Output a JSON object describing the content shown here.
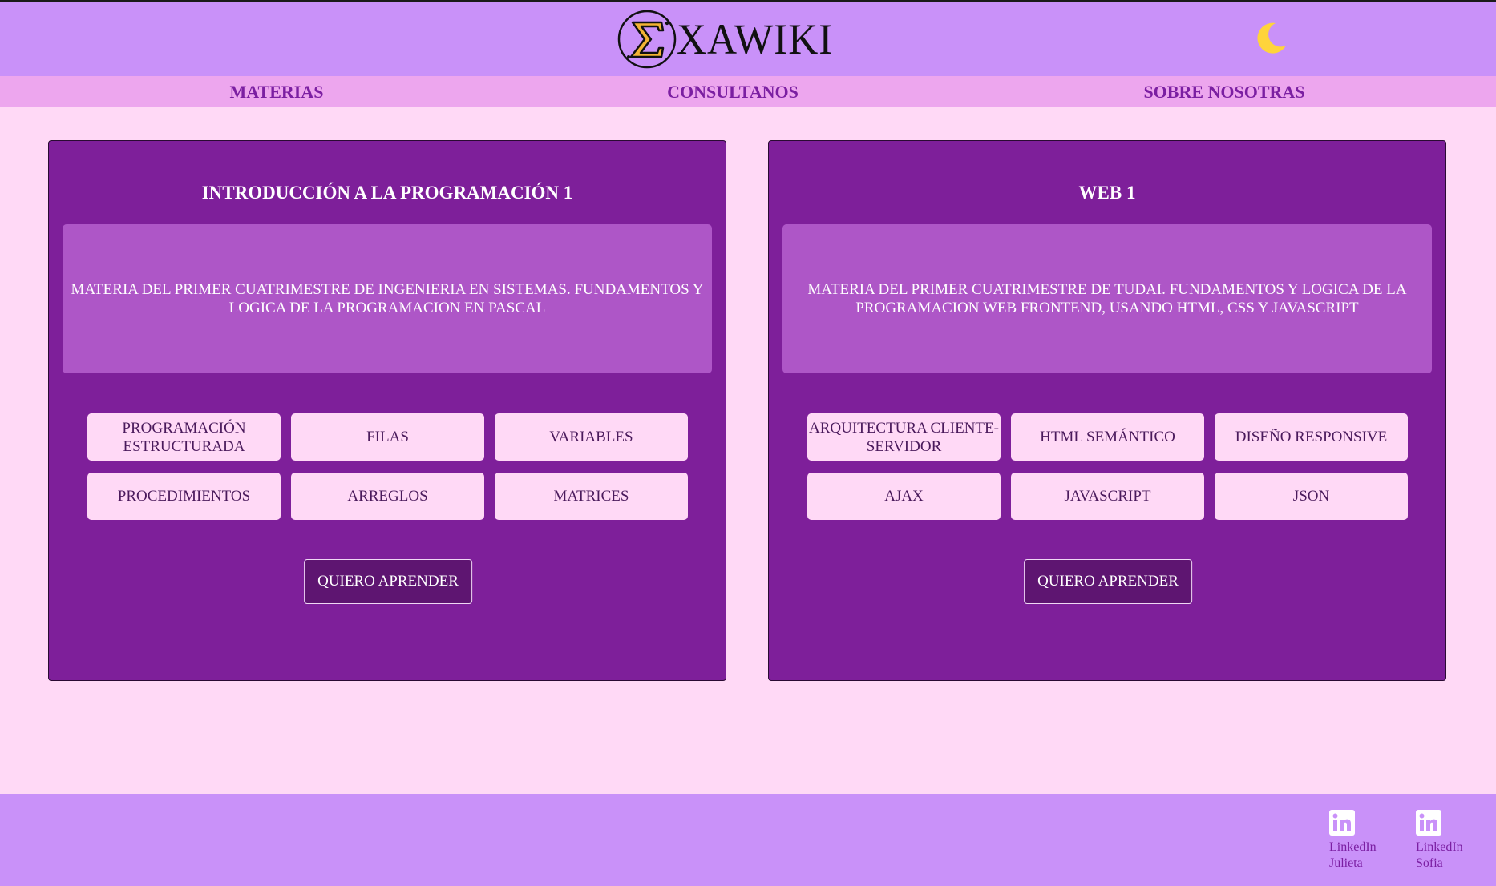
{
  "header": {
    "logo_text": "XAWIKI",
    "logo_icon": "sigma-icon",
    "theme_toggle_icon": "moon-icon"
  },
  "nav": {
    "items": [
      {
        "label": "MATERIAS"
      },
      {
        "label": "CONSULTANOS"
      },
      {
        "label": "SOBRE NOSOTRAS"
      }
    ]
  },
  "courses": [
    {
      "title": "INTRODUCCIÓN A LA PROGRAMACIÓN 1",
      "description": "MATERIA DEL PRIMER CUATRIMESTRE DE INGENIERIA EN SISTEMAS. FUNDAMENTOS Y LOGICA DE LA PROGRAMACION EN PASCAL",
      "topics": [
        "PROGRAMACIÓN ESTRUCTURADA",
        "FILAS",
        "VARIABLES",
        "PROCEDIMIENTOS",
        "ARREGLOS",
        "MATRICES"
      ],
      "button_label": "QUIERO APRENDER"
    },
    {
      "title": "WEB 1",
      "description": "MATERIA DEL PRIMER CUATRIMESTRE DE TUDAI. FUNDAMENTOS Y LOGICA DE LA PROGRAMACION WEB FRONTEND, USANDO HTML, CSS Y JAVASCRIPT",
      "topics": [
        "ARQUITECTURA CLIENTE-SERVIDOR",
        "HTML SEMÁNTICO",
        "DISEÑO RESPONSIVE",
        "AJAX",
        "JAVASCRIPT",
        "JSON"
      ],
      "button_label": "QUIERO APRENDER"
    }
  ],
  "footer": {
    "links": [
      {
        "icon": "linkedin-icon",
        "line1": "LinkedIn",
        "line2": "Julieta"
      },
      {
        "icon": "linkedin-icon",
        "line1": "LinkedIn",
        "line2": "Sofia"
      }
    ]
  },
  "colors": {
    "background": "#ffd9f6",
    "header": "#c991f9",
    "nav": "#eda6ee",
    "card": "#7e1f9a",
    "description_box": "#ae56c7",
    "topic": "#ffd9f6",
    "button": "#5e1571",
    "accent_text": "#7b1fa2",
    "moon": "#ffd43b"
  }
}
